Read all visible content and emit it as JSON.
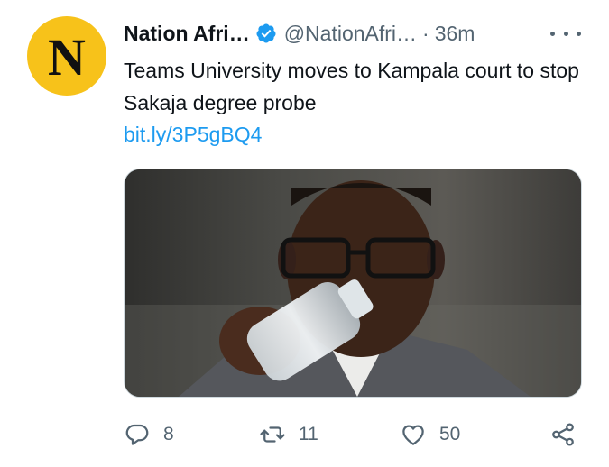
{
  "tweet": {
    "avatar": {
      "letter": "N",
      "color": "#f7c21a",
      "icon": "nation-logo-icon"
    },
    "author": {
      "name": "Nation Afri…",
      "handle": "@NationAfri…",
      "verified": true,
      "separator": "·",
      "time": "36m"
    },
    "text": "Teams University moves to Kampala court to stop Sakaja degree probe",
    "link": "bit.ly/3P5gBQ4",
    "media": {
      "kind": "photo",
      "icon": "tweet-photo"
    },
    "actions": {
      "replies": "8",
      "retweets": "11",
      "likes": "50"
    },
    "colors": {
      "link": "#1d9bf0",
      "secondary_text": "#536471",
      "verified": "#1d9bf0"
    }
  }
}
